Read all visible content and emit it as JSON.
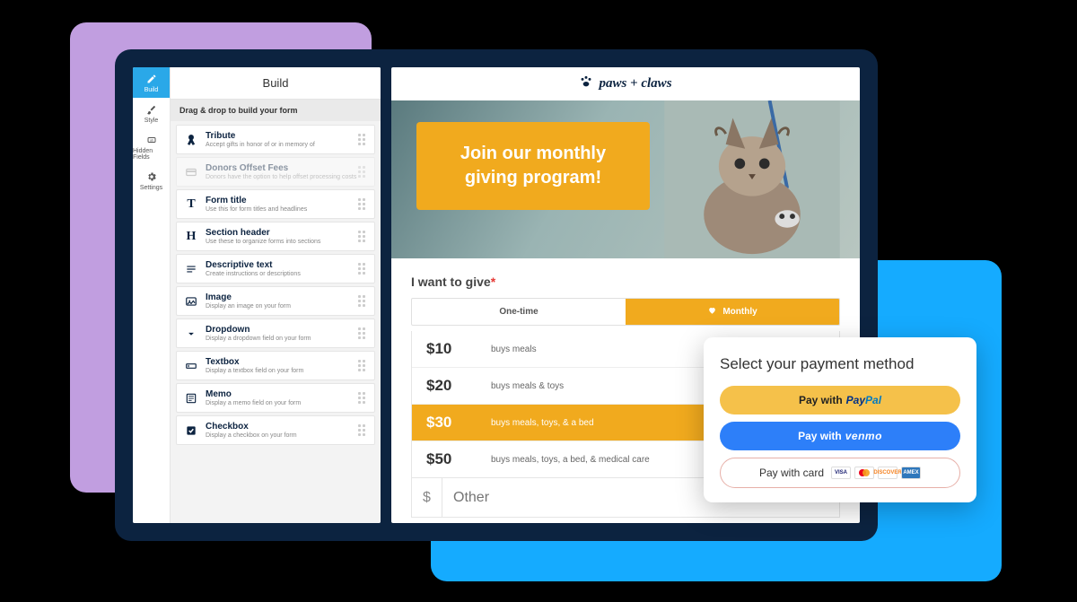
{
  "sidebar": {
    "tabs": [
      {
        "id": "build",
        "label": "Build",
        "active": true,
        "icon": "pencil-icon"
      },
      {
        "id": "style",
        "label": "Style",
        "active": false,
        "icon": "brush-icon"
      },
      {
        "id": "hidden",
        "label": "Hidden Fields",
        "active": false,
        "icon": "hidden-field-icon"
      },
      {
        "id": "settings",
        "label": "Settings",
        "active": false,
        "icon": "gear-icon"
      }
    ],
    "header": "Build",
    "hint": "Drag & drop to build your form",
    "tools": [
      {
        "id": "tribute",
        "title": "Tribute",
        "desc": "Accept gifts in honor of or in memory of",
        "icon": "ribbon-icon",
        "disabled": false
      },
      {
        "id": "offset",
        "title": "Donors Offset Fees",
        "desc": "Donors have the option to help offset processing costs",
        "icon": "card-icon",
        "disabled": true
      },
      {
        "id": "formtitle",
        "title": "Form title",
        "desc": "Use this for form titles and headlines",
        "icon": "title-t-icon",
        "disabled": false
      },
      {
        "id": "section",
        "title": "Section header",
        "desc": "Use these to organize forms into sections",
        "icon": "title-h-icon",
        "disabled": false
      },
      {
        "id": "desctext",
        "title": "Descriptive text",
        "desc": "Create instructions or descriptions",
        "icon": "lines-icon",
        "disabled": false
      },
      {
        "id": "image",
        "title": "Image",
        "desc": "Display an image on your form",
        "icon": "image-icon",
        "disabled": false
      },
      {
        "id": "dropdown",
        "title": "Dropdown",
        "desc": "Display a dropdown field on your form",
        "icon": "chevron-down-icon",
        "disabled": false
      },
      {
        "id": "textbox",
        "title": "Textbox",
        "desc": "Display a textbox field on your form",
        "icon": "textbox-icon",
        "disabled": false
      },
      {
        "id": "memo",
        "title": "Memo",
        "desc": "Display a memo field on your form",
        "icon": "memo-icon",
        "disabled": false
      },
      {
        "id": "checkbox",
        "title": "Checkbox",
        "desc": "Display a checkbox on your form",
        "icon": "checkbox-icon",
        "disabled": false
      }
    ]
  },
  "preview": {
    "brand": "paws + claws",
    "hero_text": "Join our monthly giving program!",
    "give_label": "I want to give",
    "required_mark": "*",
    "frequency": {
      "onetime": "One-time",
      "monthly": "Monthly",
      "selected": "monthly"
    },
    "amounts": [
      {
        "amount": "$10",
        "desc": "buys meals",
        "selected": false
      },
      {
        "amount": "$20",
        "desc": "buys meals & toys",
        "selected": false
      },
      {
        "amount": "$30",
        "desc": "buys meals, toys, & a bed",
        "selected": true
      },
      {
        "amount": "$50",
        "desc": "buys meals, toys, a bed, & medical care",
        "selected": false
      }
    ],
    "other": {
      "currency": "$",
      "placeholder": "Other"
    }
  },
  "payment": {
    "title": "Select your payment method",
    "paypal_prefix": "Pay with ",
    "paypal_brand1": "Pay",
    "paypal_brand2": "Pal",
    "venmo_prefix": "Pay with ",
    "venmo_brand": "venmo",
    "card_label": "Pay with card",
    "cards": [
      "VISA",
      "MC",
      "DISCOVER",
      "AMEX"
    ]
  }
}
